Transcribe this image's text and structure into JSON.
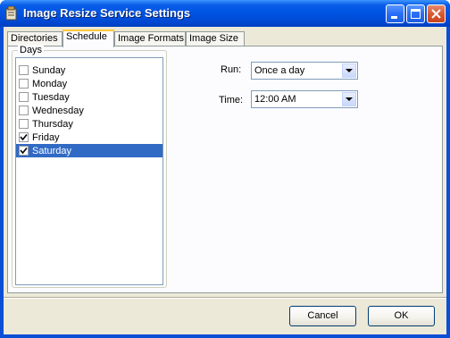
{
  "window": {
    "title": "Image Resize Service Settings"
  },
  "tabs": [
    {
      "label": "Directories"
    },
    {
      "label": "Schedule"
    },
    {
      "label": "Image Formats"
    },
    {
      "label": "Image Size"
    }
  ],
  "active_tab": "Schedule",
  "days_group": {
    "label": "Days",
    "items": [
      {
        "label": "Sunday",
        "checked": false
      },
      {
        "label": "Monday",
        "checked": false
      },
      {
        "label": "Tuesday",
        "checked": false
      },
      {
        "label": "Wednesday",
        "checked": false
      },
      {
        "label": "Thursday",
        "checked": false
      },
      {
        "label": "Friday",
        "checked": true
      },
      {
        "label": "Saturday",
        "checked": true,
        "selected": true
      }
    ]
  },
  "run": {
    "label": "Run:",
    "value": "Once a day"
  },
  "time": {
    "label": "Time:",
    "value": "12:00 AM"
  },
  "buttons": {
    "cancel": "Cancel",
    "ok": "OK"
  },
  "icons": {
    "app": "service-icon",
    "minimize": "minimize-icon",
    "maximize": "maximize-icon",
    "close": "close-icon",
    "dropdown": "chevron-down-icon",
    "check": "checkmark-icon"
  }
}
